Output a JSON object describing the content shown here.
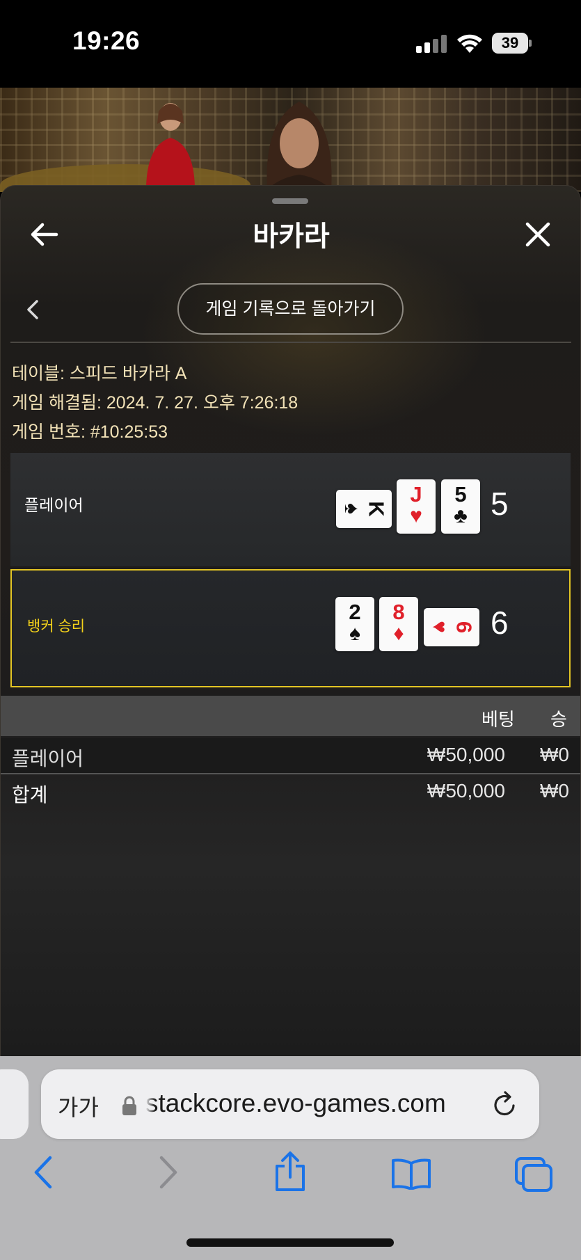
{
  "status_bar": {
    "time": "19:26",
    "battery": "39"
  },
  "panel": {
    "title": "바카라",
    "history_button_label": "게임 기록으로 돌아가기",
    "info": {
      "table": "테이블: 스피드 바카라 A",
      "resolved": "게임 해결됨: 2024. 7. 27. 오후 7:26:18",
      "game_number": "게임 번호: #10:25:53"
    },
    "player_hand": {
      "label": "플레이어",
      "score": "5",
      "cards": [
        {
          "rank": "K",
          "suit": "♠",
          "color": "#111111"
        },
        {
          "rank": "J",
          "suit": "♥",
          "color": "#e0202a"
        },
        {
          "rank": "5",
          "suit": "♣",
          "color": "#111111"
        }
      ]
    },
    "banker_hand": {
      "label": "뱅커 승리",
      "score": "6",
      "cards": [
        {
          "rank": "2",
          "suit": "♠",
          "color": "#111111"
        },
        {
          "rank": "8",
          "suit": "♦",
          "color": "#e0202a"
        },
        {
          "rank": "6",
          "suit": "♥",
          "color": "#e0202a"
        }
      ]
    },
    "bets_table": {
      "headers": {
        "bet": "베팅",
        "win": "승"
      },
      "rows": [
        {
          "name": "플레이어",
          "bet": "₩50,000",
          "win": "₩0"
        },
        {
          "name": "합계",
          "bet": "₩50,000",
          "win": "₩0"
        }
      ]
    },
    "accent_color": "#e3c524"
  },
  "browser": {
    "text_size_label": "가가",
    "url": "stackcore.evo-games.com",
    "accent_color": "#1a73e8"
  }
}
